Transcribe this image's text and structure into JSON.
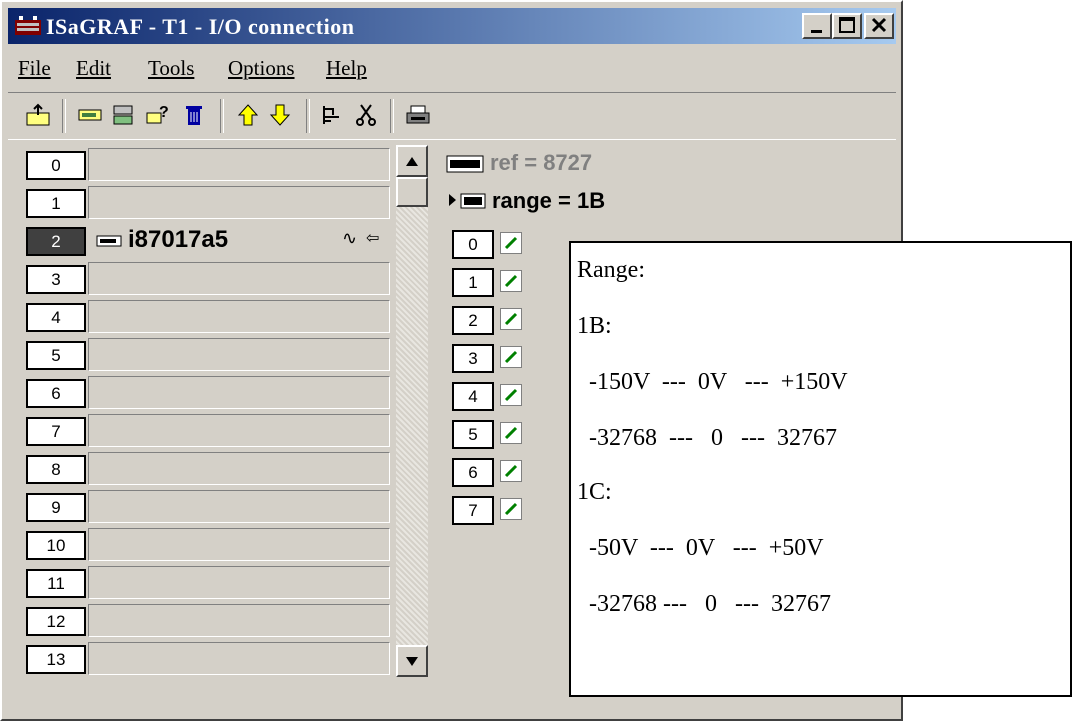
{
  "window": {
    "title": "ISaGRAF - T1 - I/O connection",
    "buttons": [
      "minimize",
      "maximize",
      "close"
    ]
  },
  "menu": [
    "File",
    "Edit",
    "Tools",
    "Options",
    "Help"
  ],
  "toolbar_icons": [
    "open-icon",
    "board-icon",
    "equipment-icon",
    "query-icon",
    "delete-icon",
    "up-arrow-icon",
    "down-arrow-icon",
    "connect-icon",
    "cut-icon",
    "print-icon"
  ],
  "slots": [
    {
      "num": "0",
      "board": ""
    },
    {
      "num": "1",
      "board": ""
    },
    {
      "num": "2",
      "board": "i87017a5",
      "selected": true
    },
    {
      "num": "3",
      "board": ""
    },
    {
      "num": "4",
      "board": ""
    },
    {
      "num": "5",
      "board": ""
    },
    {
      "num": "6",
      "board": ""
    },
    {
      "num": "7",
      "board": ""
    },
    {
      "num": "8",
      "board": ""
    },
    {
      "num": "9",
      "board": ""
    },
    {
      "num": "10",
      "board": ""
    },
    {
      "num": "11",
      "board": ""
    },
    {
      "num": "12",
      "board": ""
    },
    {
      "num": "13",
      "board": ""
    }
  ],
  "params": {
    "ref": "ref = 8727",
    "range": "range = 1B"
  },
  "channels": [
    "0",
    "1",
    "2",
    "3",
    "4",
    "5",
    "6",
    "7"
  ],
  "note": {
    "lines": [
      "Range:",
      "1B:",
      "  -150V  ---  0V   ---  +150V",
      "  -32768  ---   0   ---  32767",
      "1C:",
      "  -50V  ---  0V   ---  +50V",
      "  -32768 ---   0   ---  32767"
    ]
  },
  "colors": {
    "title_start": "#0a246a",
    "title_end": "#a6caf0",
    "face": "#d4d0c8",
    "ref_text": "#808080"
  }
}
